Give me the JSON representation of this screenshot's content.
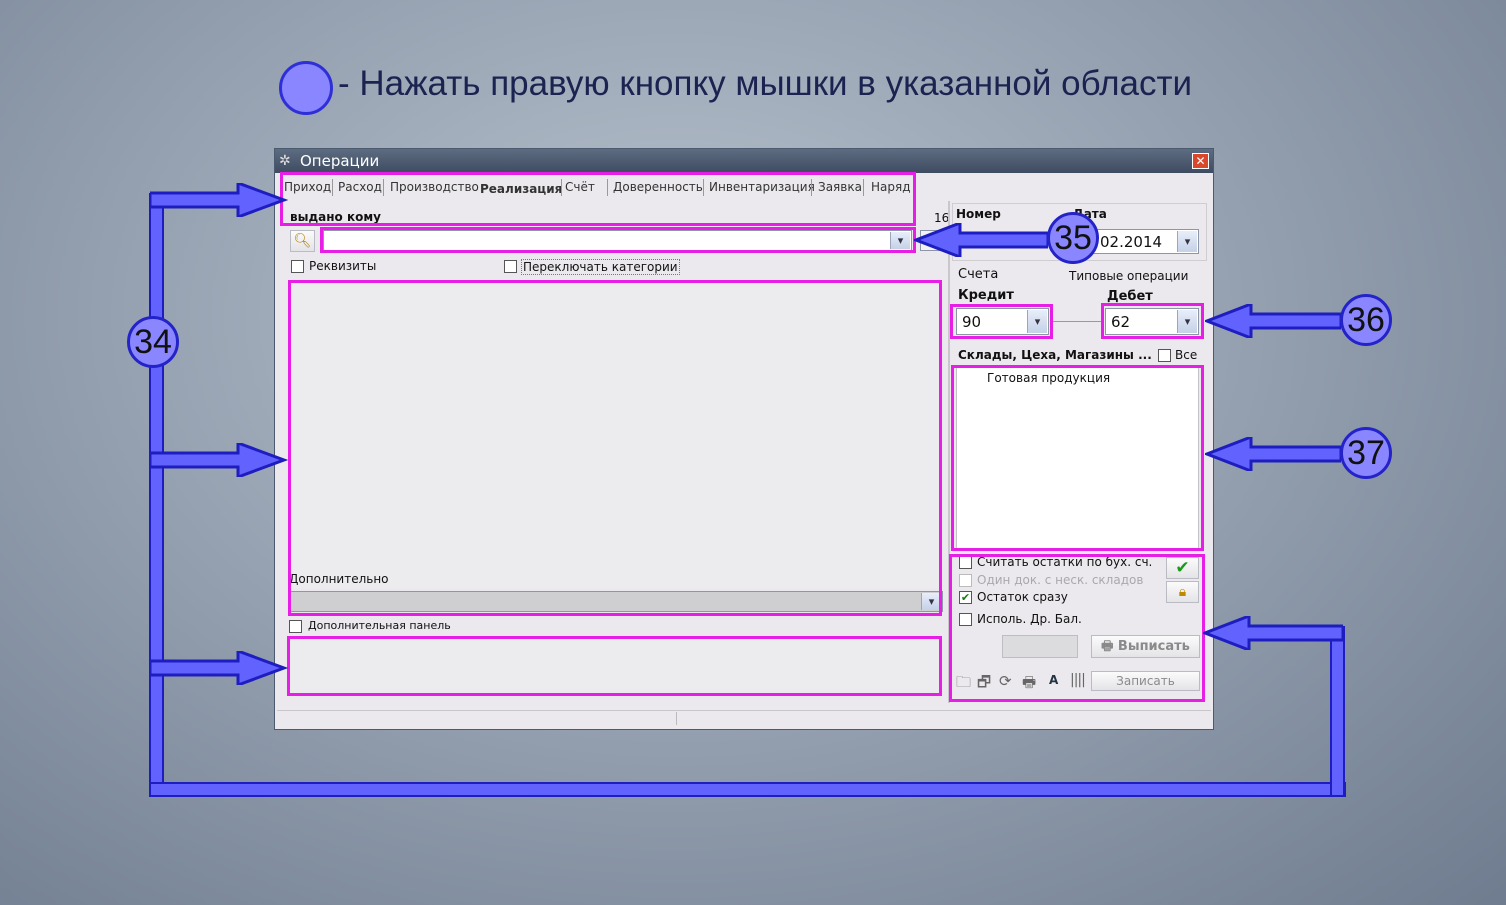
{
  "legend": {
    "text": "- Нажать правую кнопку мышки в указанной области"
  },
  "window": {
    "title": "Операции",
    "tabs": [
      "Приход",
      "Расход",
      "Производство",
      "Реализация",
      "Счёт",
      "Доверенность",
      "Инвентаризация",
      "Заявка",
      "Наряд"
    ],
    "active_tab": "Реализация",
    "issued_to_label": "выдано кому",
    "counter": "16",
    "requisites_label": "Реквизиты",
    "switch_categories_label": "Переключать категории",
    "additional_label": "Дополнительно",
    "additional_panel_label": "Дополнительная панель",
    "number_label": "Номер",
    "date_label": "Дата",
    "date_value": "02.2014",
    "accounts_label": "Счета",
    "typical_ops_label": "Типовые операции",
    "credit_label": "Кредит",
    "debit_label": "Дебет",
    "credit_value": "90",
    "debit_value": "62",
    "warehouses_label": "Склады, Цеха, Магазины ...",
    "all_label": "Все",
    "warehouse_items": [
      "Готовая продукция"
    ],
    "options": [
      {
        "label": "Считать остатки по бух. сч.",
        "checked": false,
        "enabled": true
      },
      {
        "label": "Один док. с неск. складов",
        "checked": false,
        "enabled": false
      },
      {
        "label": "Остаток сразу",
        "checked": true,
        "enabled": true
      },
      {
        "label": "Исполь. Др. Бал.",
        "checked": false,
        "enabled": true
      }
    ],
    "write_out_label": "Выписать",
    "save_label": "Записать",
    "font_glyph": "A"
  },
  "annotations": {
    "a34": "34",
    "a35": "35",
    "a36": "36",
    "a37": "37"
  },
  "colors": {
    "highlight": "#e61ee6",
    "annotation_fill": "#8a86ff",
    "annotation_stroke": "#2323c8"
  }
}
